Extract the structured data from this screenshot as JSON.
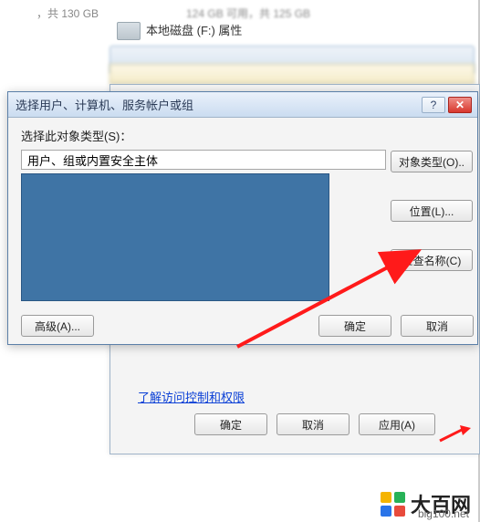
{
  "background": {
    "info_text": "，共 130 GB",
    "info_text2": "124 GB 可用，共 125 GB",
    "drive_label": "本地磁盘 (F:) 属性"
  },
  "prop_window": {
    "link_text": "了解访问控制和权限",
    "buttons": {
      "ok": "确定",
      "cancel": "取消",
      "apply": "应用(A)"
    }
  },
  "select_dialog": {
    "title": "选择用户、计算机、服务帐户或组",
    "help_icon": "?",
    "close_icon": "✕",
    "label_object_type": "选择此对象类型(S)：",
    "object_type_value": "用户、组或内置安全主体",
    "buttons": {
      "object_types": "对象类型(O)..",
      "locations": "位置(L)...",
      "check_names": "检查名称(C)",
      "advanced": "高级(A)...",
      "ok": "确定",
      "cancel": "取消"
    }
  },
  "footer": {
    "brand": "大百网",
    "url": "big100.net"
  }
}
